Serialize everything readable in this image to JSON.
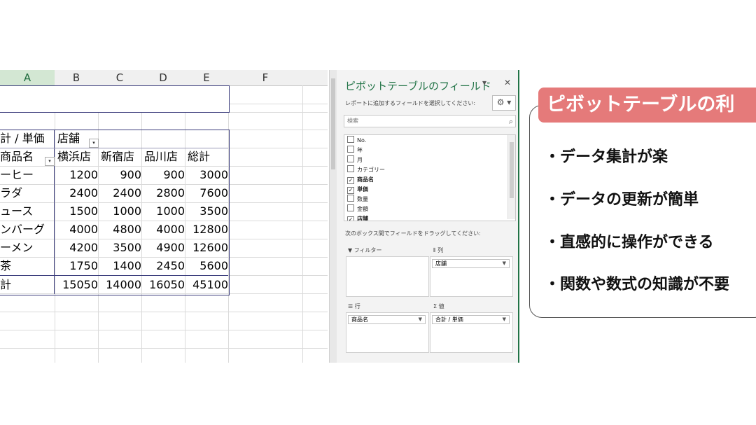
{
  "sheet": {
    "columns": [
      "A",
      "B",
      "C",
      "D",
      "E",
      "F"
    ],
    "pivot": {
      "value_header": "計 / 単価",
      "col_field": "店舗",
      "row_field": "商品名",
      "stores": [
        "横浜店",
        "新宿店",
        "品川店",
        "総計"
      ],
      "rows": [
        {
          "name": "ーヒー",
          "values": [
            "1200",
            "900",
            "900",
            "3000"
          ]
        },
        {
          "name": "ラダ",
          "values": [
            "2400",
            "2400",
            "2800",
            "7600"
          ]
        },
        {
          "name": "ュース",
          "values": [
            "1500",
            "1000",
            "1000",
            "3500"
          ]
        },
        {
          "name": "ンバーグ",
          "values": [
            "4000",
            "4800",
            "4000",
            "12800"
          ]
        },
        {
          "name": "ーメン",
          "values": [
            "4200",
            "3500",
            "4900",
            "12600"
          ]
        },
        {
          "name": "茶",
          "values": [
            "1750",
            "1400",
            "2450",
            "5600"
          ]
        }
      ],
      "total": {
        "name": "計",
        "values": [
          "15050",
          "14000",
          "16050",
          "45100"
        ]
      }
    }
  },
  "pane": {
    "title": "ピボットテーブルのフィールド",
    "subtitle": "レポートに追加するフィールドを選択してください:",
    "search_placeholder": "検索",
    "fields": [
      {
        "label": "No.",
        "checked": false
      },
      {
        "label": "年",
        "checked": false
      },
      {
        "label": "月",
        "checked": false
      },
      {
        "label": "カテゴリー",
        "checked": false
      },
      {
        "label": "商品名",
        "checked": true
      },
      {
        "label": "単価",
        "checked": true
      },
      {
        "label": "数量",
        "checked": false
      },
      {
        "label": "金額",
        "checked": false
      },
      {
        "label": "店舗",
        "checked": true
      }
    ],
    "drag_hint": "次のボックス間でフィールドをドラッグしてください:",
    "areas": {
      "filter_label": "フィルター",
      "columns_label": "列",
      "columns_value": "店舗",
      "rows_label": "行",
      "rows_value": "商品名",
      "values_label": "値",
      "values_value": "合計 / 単価"
    }
  },
  "card": {
    "title": "ピボットテーブルの利",
    "items": [
      "・データ集計が楽",
      "・データの更新が簡単",
      "・直感的に操作ができる",
      "・関数や数式の知識が不要"
    ]
  }
}
